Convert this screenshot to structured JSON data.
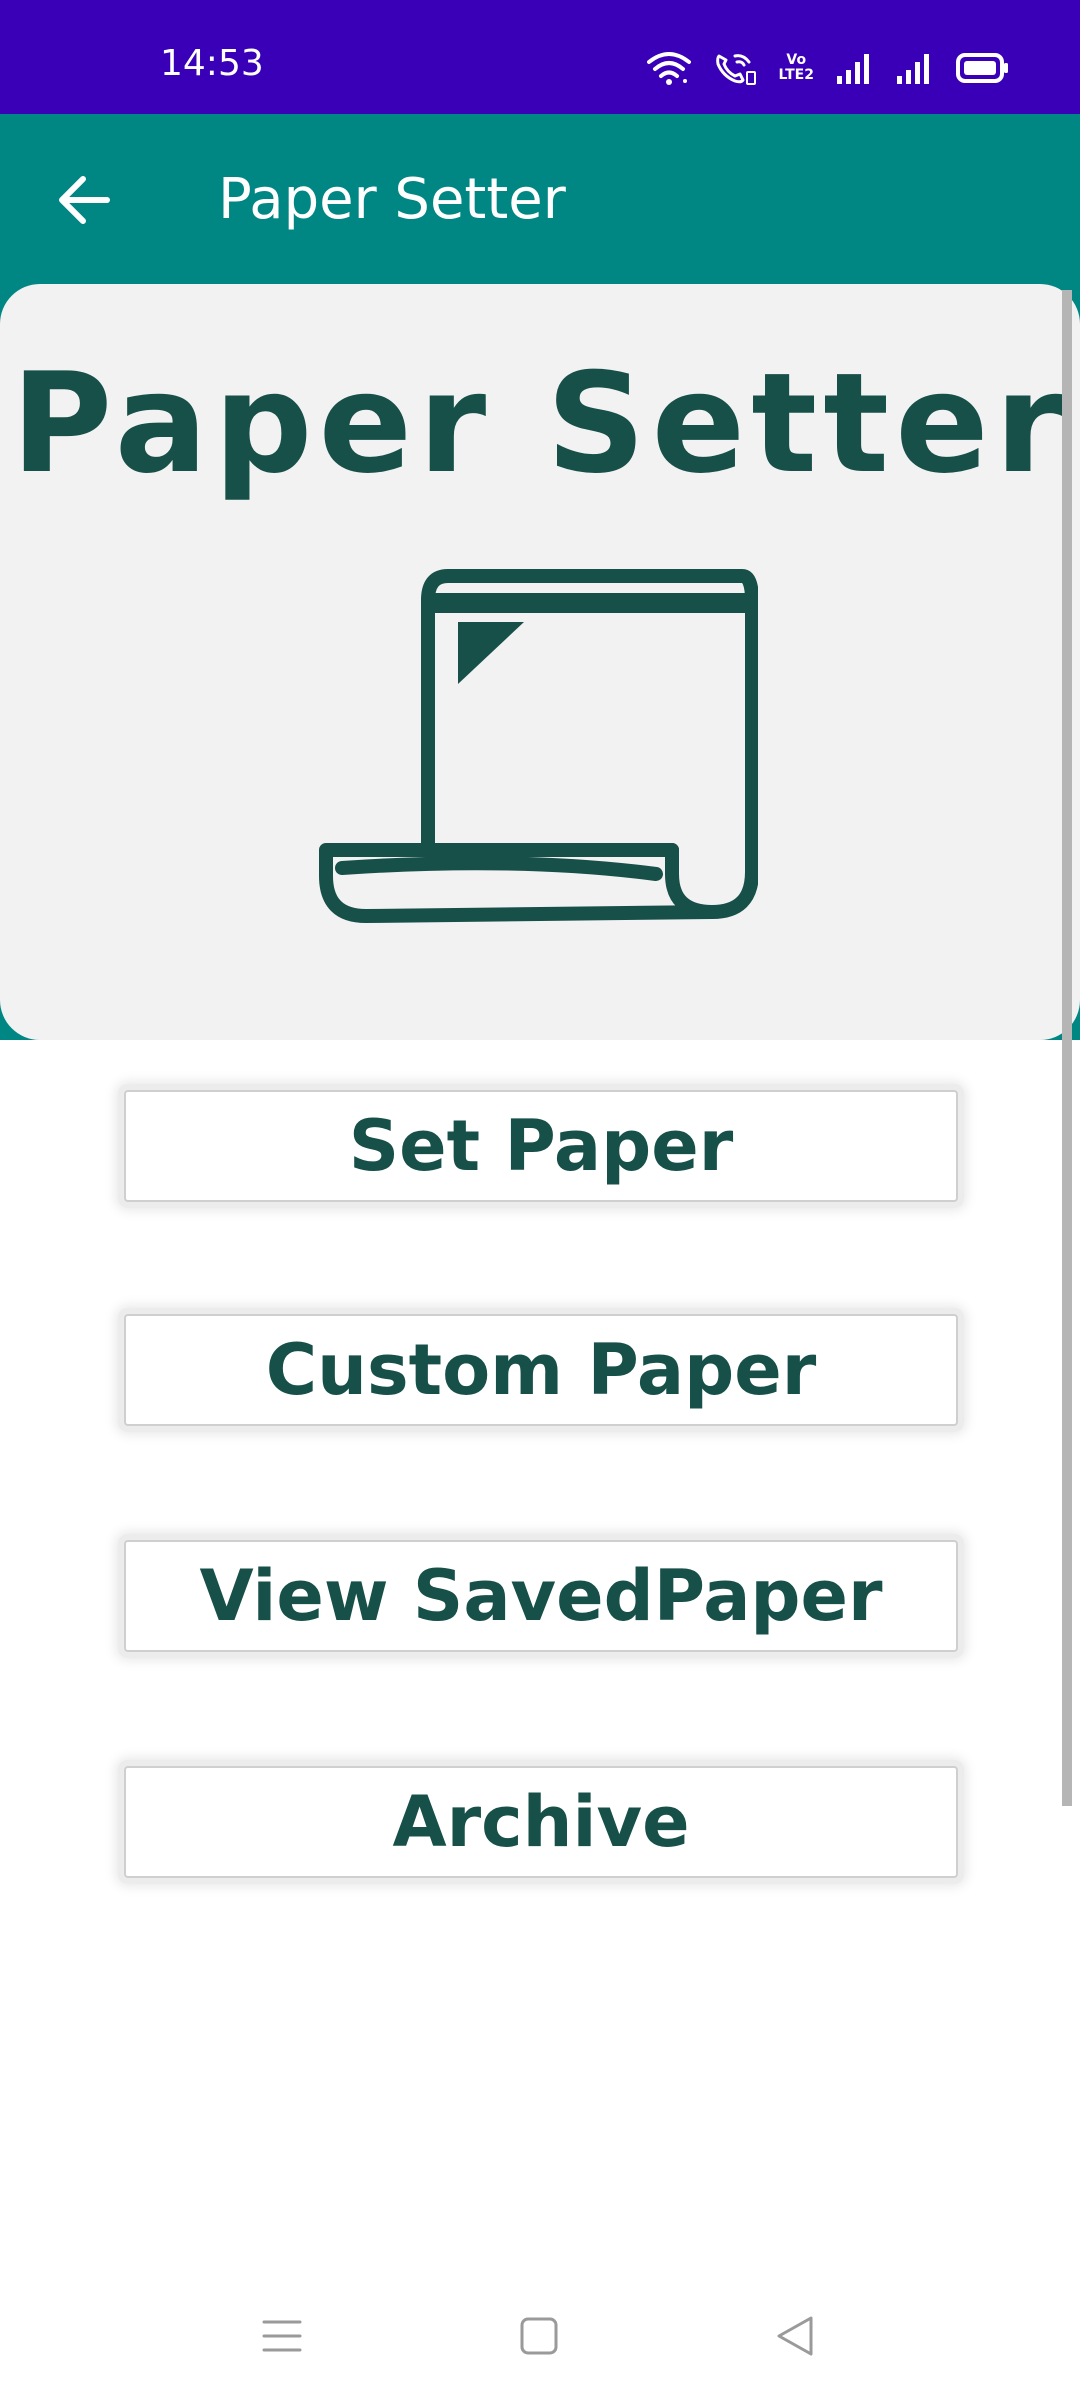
{
  "status_bar": {
    "time": "14:53",
    "volte_top": "Vo",
    "volte_bottom": "LTE2",
    "icons": [
      "wifi-icon",
      "wifi-calling-icon",
      "volte-icon",
      "signal-icon",
      "signal-icon",
      "battery-icon"
    ]
  },
  "app_bar": {
    "title": "Paper Setter",
    "back_icon": "arrow-left-icon"
  },
  "hero": {
    "title": "Paper Setter",
    "icon": "paper-scroll-icon"
  },
  "menu": {
    "set_paper": "Set Paper",
    "custom_paper": "Custom Paper",
    "view_saved_paper": "View SavedPaper",
    "archive": "Archive"
  },
  "nav_bar": {
    "icons": [
      "menu-icon",
      "home-icon",
      "back-icon"
    ]
  },
  "colors": {
    "status_bar": "#3a00b8",
    "app_bar": "#008784",
    "accent_text": "#175048",
    "card_background": "#f2f2f2"
  }
}
